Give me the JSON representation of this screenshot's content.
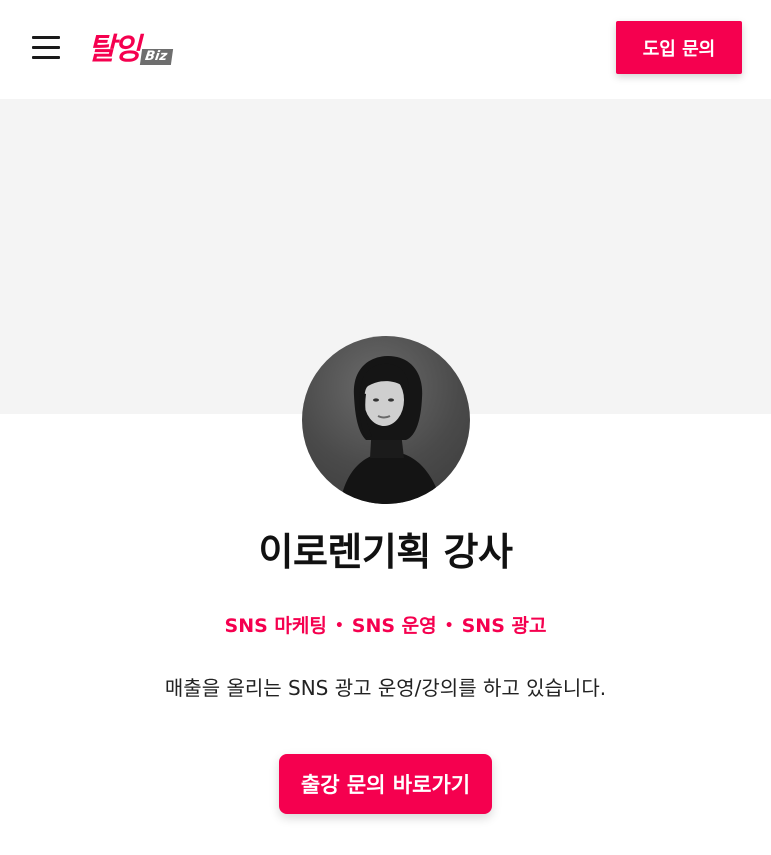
{
  "header": {
    "logo_text": "탈잉",
    "logo_badge": "Biz",
    "menu_icon": "hamburger-menu-icon",
    "cta_label": "도입 문의"
  },
  "profile": {
    "avatar_icon": "instructor-portrait",
    "name": "이로렌기획 강사",
    "tags": [
      "SNS 마케팅",
      "SNS 운영",
      "SNS 광고"
    ],
    "tag_separator": "•",
    "description": "매출을 올리는 SNS 광고 운영/강의를 하고 있습니다.",
    "cta_label": "출강 문의 바로가기"
  },
  "colors": {
    "brand": "#f5004f",
    "banner_bg": "#f4f4f4",
    "text": "#111111"
  }
}
